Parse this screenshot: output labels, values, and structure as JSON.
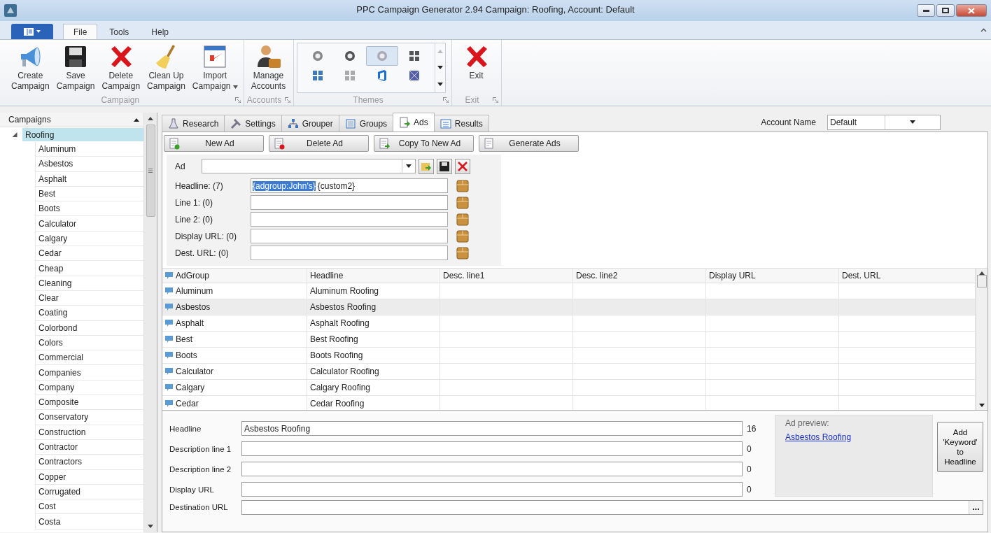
{
  "window": {
    "title": "PPC Campaign Generator 2.94 Campaign: Roofing, Account: Default"
  },
  "ribbon": {
    "tabs": [
      {
        "label": "File",
        "selected": true
      },
      {
        "label": "Tools",
        "selected": false
      },
      {
        "label": "Help",
        "selected": false
      }
    ],
    "groups": [
      {
        "kind": "buttons",
        "label": "Campaign",
        "buttons": [
          {
            "lines": [
              "Create",
              "Campaign"
            ],
            "has_menu": false
          },
          {
            "lines": [
              "Save",
              "Campaign"
            ],
            "has_menu": false
          },
          {
            "lines": [
              "Delete",
              "Campaign"
            ],
            "has_menu": false
          },
          {
            "lines": [
              "Clean Up",
              "Campaign"
            ],
            "has_menu": false
          },
          {
            "lines": [
              "Import",
              "Campaign"
            ],
            "has_menu": true
          }
        ]
      },
      {
        "kind": "buttons",
        "label": "Accounts",
        "buttons": [
          {
            "lines": [
              "Manage",
              "Accounts"
            ],
            "has_menu": false
          }
        ]
      },
      {
        "kind": "gallery",
        "label": "Themes",
        "themes": [
          {
            "selected": false
          },
          {
            "selected": false
          },
          {
            "selected": true
          },
          {
            "selected": false
          },
          {
            "selected": false
          },
          {
            "selected": false
          },
          {
            "selected": false
          },
          {
            "selected": false
          }
        ]
      },
      {
        "kind": "buttons",
        "label": "Exit",
        "buttons": [
          {
            "lines": [
              "Exit"
            ],
            "has_menu": false
          }
        ]
      }
    ]
  },
  "sidebar": {
    "header": "Campaigns",
    "tree": [
      {
        "label": "Roofing",
        "selected": true,
        "expanded": true,
        "children": [
          {
            "label": "Aluminum",
            "selected": false
          },
          {
            "label": "Asbestos",
            "selected": false
          },
          {
            "label": "Asphalt",
            "selected": false
          },
          {
            "label": "Best",
            "selected": false
          },
          {
            "label": "Boots",
            "selected": false
          },
          {
            "label": "Calculator",
            "selected": false
          },
          {
            "label": "Calgary",
            "selected": false
          },
          {
            "label": "Cedar",
            "selected": false
          },
          {
            "label": "Cheap",
            "selected": false
          },
          {
            "label": "Cleaning",
            "selected": false
          },
          {
            "label": "Clear",
            "selected": false
          },
          {
            "label": "Coating",
            "selected": false
          },
          {
            "label": "Colorbond",
            "selected": false
          },
          {
            "label": "Colors",
            "selected": false
          },
          {
            "label": "Commercial",
            "selected": false
          },
          {
            "label": "Companies",
            "selected": false
          },
          {
            "label": "Company",
            "selected": false
          },
          {
            "label": "Composite",
            "selected": false
          },
          {
            "label": "Conservatory",
            "selected": false
          },
          {
            "label": "Construction",
            "selected": false
          },
          {
            "label": "Contractor",
            "selected": false
          },
          {
            "label": "Contractors",
            "selected": false
          },
          {
            "label": "Copper",
            "selected": false
          },
          {
            "label": "Corrugated",
            "selected": false
          },
          {
            "label": "Cost",
            "selected": false
          },
          {
            "label": "Costa",
            "selected": false
          }
        ]
      }
    ]
  },
  "tabs": [
    {
      "label": "Research",
      "selected": false
    },
    {
      "label": "Settings",
      "selected": false
    },
    {
      "label": "Grouper",
      "selected": false
    },
    {
      "label": "Groups",
      "selected": false
    },
    {
      "label": "Ads",
      "selected": true
    },
    {
      "label": "Results",
      "selected": false
    }
  ],
  "account": {
    "label": "Account Name",
    "value": "Default"
  },
  "toolbar": [
    {
      "label": "New Ad"
    },
    {
      "label": "Delete Ad"
    },
    {
      "label": "Copy To New Ad"
    },
    {
      "label": "Generate Ads"
    }
  ],
  "ad_editor": {
    "ad_label": "Ad",
    "rows": [
      {
        "label": "Headline: (7)",
        "selection": "{adgroup:John's} ",
        "value": "{custom2}"
      },
      {
        "label": "Line 1: (0)"
      },
      {
        "label": "Line 2: (0)"
      },
      {
        "label": "Display URL: (0)"
      },
      {
        "label": "Dest. URL: (0)"
      }
    ]
  },
  "grid": {
    "columns": [
      "AdGroup",
      "Headline",
      "Desc. line1",
      "Desc. line2",
      "Display URL",
      "Dest. URL"
    ],
    "rows": [
      {
        "cells": [
          "Aluminum",
          "Aluminum Roofing"
        ],
        "selected": false
      },
      {
        "cells": [
          "Asbestos",
          "Asbestos Roofing"
        ],
        "selected": true
      },
      {
        "cells": [
          "Asphalt",
          "Asphalt Roofing"
        ],
        "selected": false
      },
      {
        "cells": [
          "Best",
          "Best Roofing"
        ],
        "selected": false
      },
      {
        "cells": [
          "Boots",
          "Boots Roofing"
        ],
        "selected": false
      },
      {
        "cells": [
          "Calculator",
          "Calculator Roofing"
        ],
        "selected": false
      },
      {
        "cells": [
          "Calgary",
          "Calgary Roofing"
        ],
        "selected": false
      },
      {
        "cells": [
          "Cedar",
          "Cedar Roofing"
        ],
        "selected": false
      }
    ]
  },
  "details": {
    "fields": [
      {
        "label": "Headline",
        "value": "Asbestos Roofing",
        "count": "16"
      },
      {
        "label": "Description line 1",
        "count": "0"
      },
      {
        "label": "Description line 2",
        "count": "0"
      },
      {
        "label": "Display URL",
        "count": "0"
      }
    ],
    "url_field": {
      "label": "Destination URL",
      "button": "..."
    },
    "preview": {
      "title": "Ad preview:",
      "link": "Asbestos Roofing"
    },
    "keyword_button": [
      "Add",
      "'Keyword'",
      "to",
      "Headline"
    ]
  }
}
